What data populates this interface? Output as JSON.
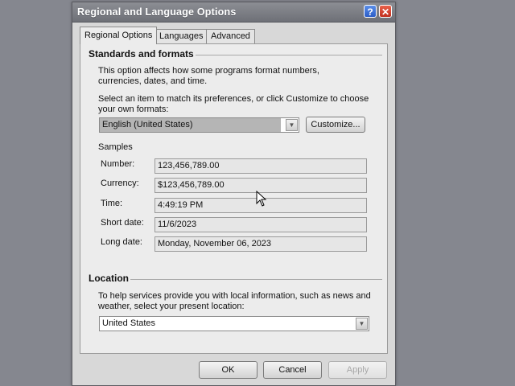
{
  "window": {
    "title": "Regional and Language Options",
    "help_symbol": "?",
    "close_symbol": "✕"
  },
  "tabs": [
    {
      "label": "Regional Options",
      "active": true
    },
    {
      "label": "Languages",
      "active": false
    },
    {
      "label": "Advanced",
      "active": false
    }
  ],
  "standards": {
    "group_title": "Standards and formats",
    "description": "This option affects how some programs format numbers, currencies, dates, and time.",
    "select_prompt": "Select an item to match its preferences, or click Customize to choose your own formats:",
    "selected_locale": "English (United States)",
    "customize_label": "Customize..."
  },
  "samples": {
    "heading": "Samples",
    "items": [
      {
        "label": "Number:",
        "value": "123,456,789.00"
      },
      {
        "label": "Currency:",
        "value": "$123,456,789.00"
      },
      {
        "label": "Time:",
        "value": "4:49:19 PM"
      },
      {
        "label": "Short date:",
        "value": "11/6/2023"
      },
      {
        "label": "Long date:",
        "value": "Monday, November 06, 2023"
      }
    ]
  },
  "location": {
    "group_title": "Location",
    "description": "To help services provide you with local information, such as news and weather, select your present location:",
    "selected_location": "United States"
  },
  "footer": {
    "ok_label": "OK",
    "cancel_label": "Cancel",
    "apply_label": "Apply"
  }
}
